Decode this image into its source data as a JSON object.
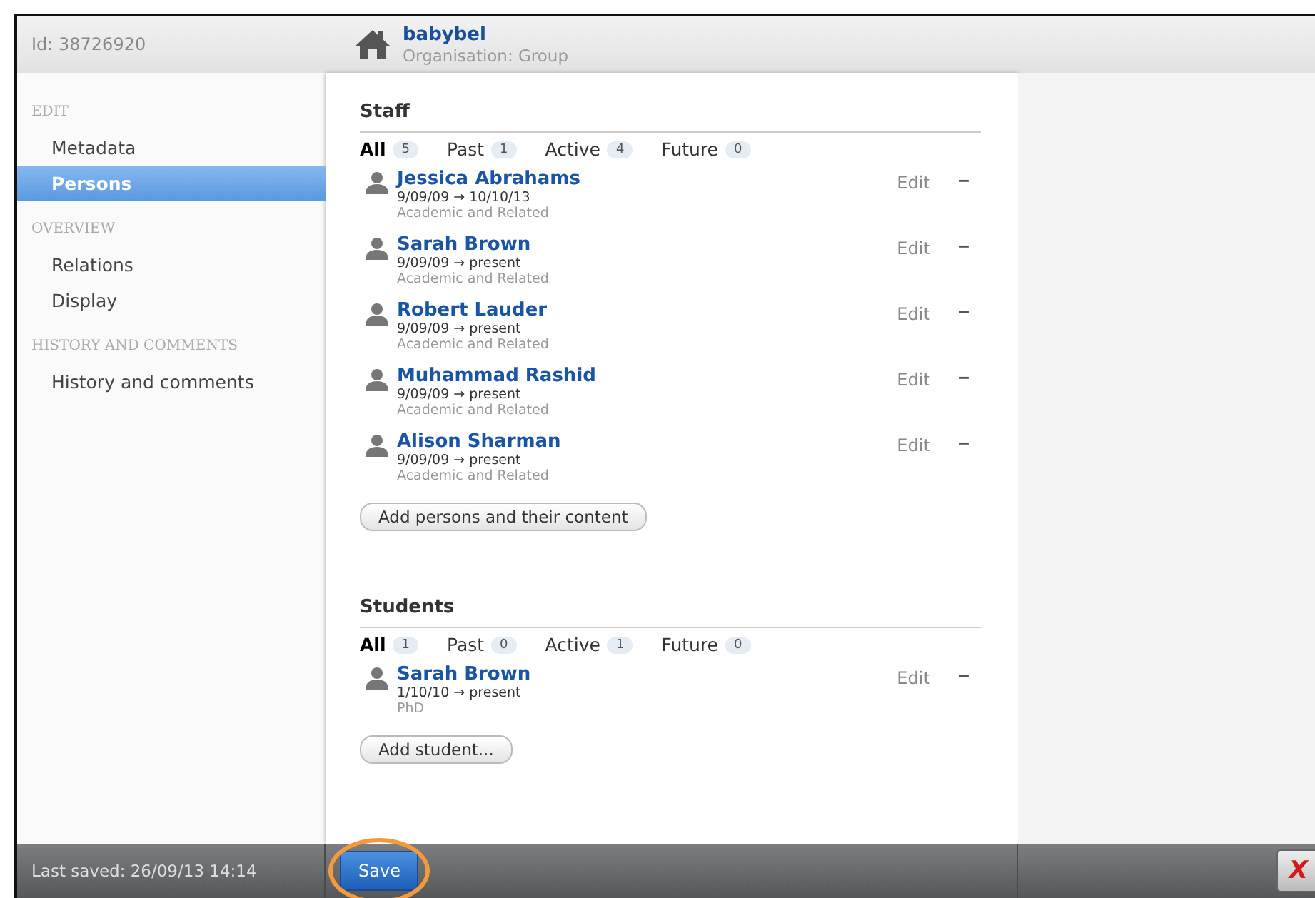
{
  "header": {
    "id_label": "Id: 38726920",
    "title": "babybel",
    "subtitle": "Organisation: Group"
  },
  "sidebar": {
    "sections": [
      {
        "heading": "EDIT",
        "items": [
          {
            "label": "Metadata",
            "selected": false
          },
          {
            "label": "Persons",
            "selected": true
          }
        ]
      },
      {
        "heading": "OVERVIEW",
        "items": [
          {
            "label": "Relations",
            "selected": false
          },
          {
            "label": "Display",
            "selected": false
          }
        ]
      },
      {
        "heading": "HISTORY AND COMMENTS",
        "items": [
          {
            "label": "History and comments",
            "selected": false
          }
        ]
      }
    ]
  },
  "sections": [
    {
      "title": "Staff",
      "filters": [
        {
          "label": "All",
          "count": "5",
          "selected": true
        },
        {
          "label": "Past",
          "count": "1",
          "selected": false
        },
        {
          "label": "Active",
          "count": "4",
          "selected": false
        },
        {
          "label": "Future",
          "count": "0",
          "selected": false
        }
      ],
      "persons": [
        {
          "name": "Jessica Abrahams",
          "period": "9/09/09 → 10/10/13",
          "role": "Academic and Related",
          "edit": "Edit",
          "remove": "−"
        },
        {
          "name": "Sarah Brown",
          "period": "9/09/09 → present",
          "role": "Academic and Related",
          "edit": "Edit",
          "remove": "−"
        },
        {
          "name": "Robert Lauder",
          "period": "9/09/09 → present",
          "role": "Academic and Related",
          "edit": "Edit",
          "remove": "−"
        },
        {
          "name": "Muhammad Rashid",
          "period": "9/09/09 → present",
          "role": "Academic and Related",
          "edit": "Edit",
          "remove": "−"
        },
        {
          "name": "Alison Sharman",
          "period": "9/09/09 → present",
          "role": "Academic and Related",
          "edit": "Edit",
          "remove": "−"
        }
      ],
      "add_button": "Add persons and their content"
    },
    {
      "title": "Students",
      "filters": [
        {
          "label": "All",
          "count": "1",
          "selected": true
        },
        {
          "label": "Past",
          "count": "0",
          "selected": false
        },
        {
          "label": "Active",
          "count": "1",
          "selected": false
        },
        {
          "label": "Future",
          "count": "0",
          "selected": false
        }
      ],
      "persons": [
        {
          "name": "Sarah Brown",
          "period": "1/10/10 → present",
          "role": "PhD",
          "edit": "Edit",
          "remove": "−"
        }
      ],
      "add_button": "Add student..."
    }
  ],
  "footer": {
    "last_saved": "Last saved: 26/09/13 14:14",
    "save_button": "Save",
    "save_highlighted": true,
    "close_button": "X"
  }
}
